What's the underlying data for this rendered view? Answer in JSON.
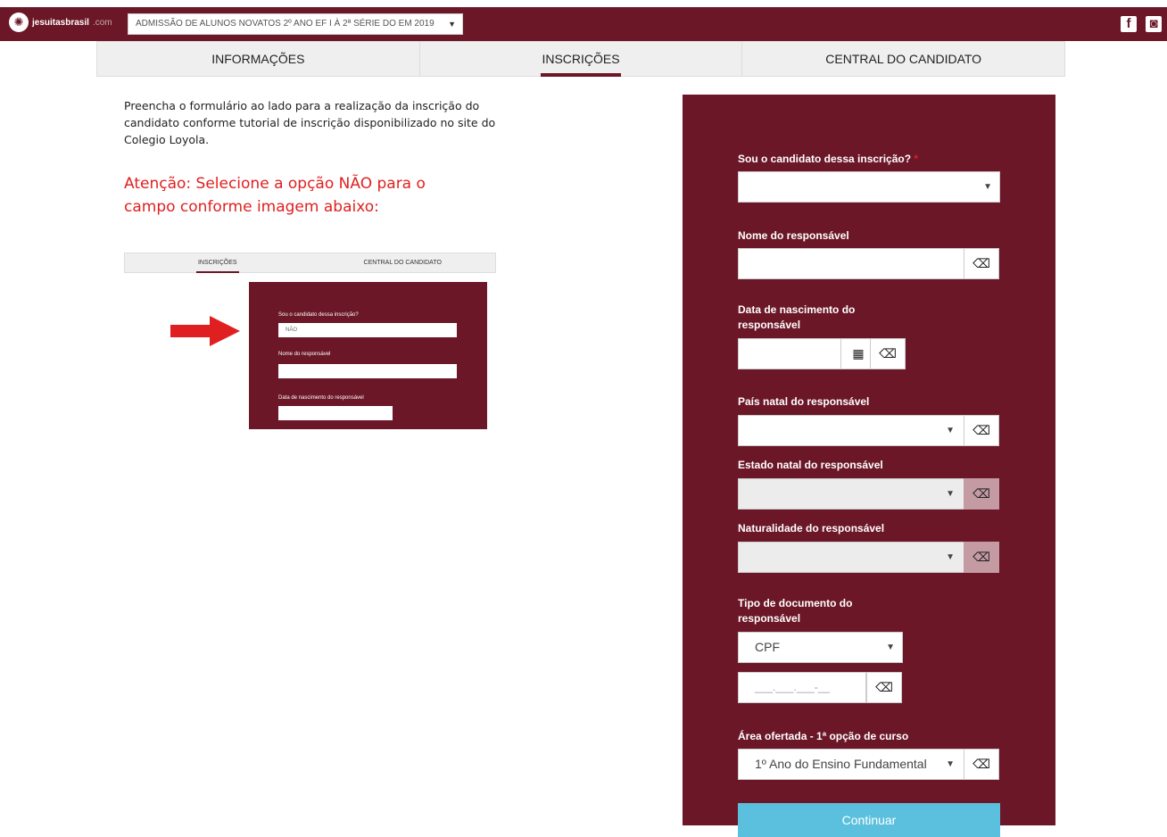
{
  "header": {
    "brand_bold": "jesuitasbrasil",
    "brand_light": ".com",
    "course_select": "ADMISSÃO DE ALUNOS NOVATOS 2º ANO EF I À 2ª SÉRIE DO EM 2019",
    "social": {
      "facebook": "f",
      "instagram": "◙"
    },
    "icons": [
      "logo-icon",
      "facebook-icon",
      "instagram-icon",
      "chevron-down-icon"
    ]
  },
  "tabs": [
    "INFORMAÇÕES",
    "INSCRIÇÕES",
    "CENTRAL DO CANDIDATO"
  ],
  "active_tab": 1,
  "intro": "Preencha o formulário ao lado para a realização da inscrição do candidato conforme tutorial de inscrição disponibilizado no site do Colegio Loyola.",
  "warning": "Atenção: Selecione a opção NÃO para o campo conforme imagem abaixo:",
  "tutorial": {
    "tabs": [
      "INSCRIÇÕES",
      "CENTRAL DO CANDIDATO"
    ],
    "label_candidate": "Sou o candidato dessa inscrição?",
    "value_candidate": "NÃO",
    "label_name": "Nome do responsável",
    "label_birth": "Data de nascimento do responsável",
    "arrow_color": "#e02020"
  },
  "form": {
    "candidate_label": "Sou o candidato dessa inscrição?",
    "required_mark": "*",
    "candidate_value": "",
    "guardian_name_label": "Nome do responsável",
    "guardian_birth_label_1": "Data de nascimento do",
    "guardian_birth_label_2": "responsável",
    "country_label": "País natal do responsável",
    "state_label": "Estado natal do responsável",
    "city_label": "Naturalidade do responsável",
    "doc_type_label_1": "Tipo de documento do",
    "doc_type_label_2": "responsável",
    "doc_type_value": "CPF",
    "doc_number_placeholder": "___.___.___-__",
    "area_label": "Área ofertada - 1ª opção de curso",
    "area_value": "1º Ano do Ensino Fundamental",
    "continue_button": "Continuar"
  },
  "colors": {
    "brand": "#6b1727",
    "button": "#5bc0de",
    "warning": "#e02020"
  }
}
